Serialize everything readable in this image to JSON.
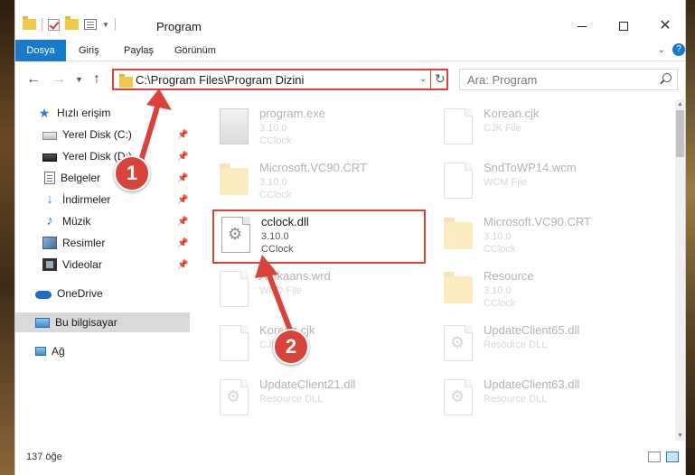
{
  "window": {
    "title": "Program"
  },
  "ribbon": {
    "tabs": [
      {
        "label": "Dosya"
      },
      {
        "label": "Giriş"
      },
      {
        "label": "Paylaş"
      },
      {
        "label": "Görünüm"
      }
    ]
  },
  "address": {
    "path": "C:\\Program Files\\Program Dizini"
  },
  "search": {
    "placeholder": "Ara: Program"
  },
  "sidebar": {
    "items": [
      {
        "label": "Hızlı erişim",
        "icon": "star-icon"
      },
      {
        "label": "Yerel Disk (C:)",
        "icon": "disk-icon",
        "pinned": true
      },
      {
        "label": "Yerel Disk (D:)",
        "icon": "disk-icon",
        "pinned": true
      },
      {
        "label": "Belgeler",
        "icon": "documents-icon",
        "pinned": true
      },
      {
        "label": "İndirmeler",
        "icon": "download-icon",
        "pinned": true
      },
      {
        "label": "Müzik",
        "icon": "music-icon",
        "pinned": true
      },
      {
        "label": "Resimler",
        "icon": "pictures-icon",
        "pinned": true
      },
      {
        "label": "Videolar",
        "icon": "videos-icon",
        "pinned": true
      },
      {
        "label": "OneDrive",
        "icon": "cloud-icon"
      },
      {
        "label": "Bu bilgisayar",
        "icon": "computer-icon",
        "selected": true
      },
      {
        "label": "Ağ",
        "icon": "network-icon"
      }
    ]
  },
  "files": [
    {
      "name": "program.exe",
      "line2": "3.10.0",
      "line3": "CClock",
      "type": "exe"
    },
    {
      "name": "Korean.cjk",
      "line2": "CJK File",
      "line3": "",
      "type": "doc"
    },
    {
      "name": "Microsoft.VC90.CRT",
      "line2": "3.10.0",
      "line3": "CClock",
      "type": "folder"
    },
    {
      "name": "SndToWP14.wcm",
      "line2": "WCM File",
      "line3": "",
      "type": "doc"
    },
    {
      "name": "cclock.dll",
      "line2": "3.10.0",
      "line3": "CClock",
      "type": "dll",
      "highlight": true
    },
    {
      "name": "Microsoft.VC90.CRT",
      "line2": "3.10.0",
      "line3": "CClock",
      "type": "folder"
    },
    {
      "name": "Afrikaans.wrd",
      "line2": "WRD File",
      "line3": "",
      "type": "doc"
    },
    {
      "name": "Resource",
      "line2": "3.10.0",
      "line3": "CClock",
      "type": "folder"
    },
    {
      "name": "Korean.cjk",
      "line2": "CJK File",
      "line3": "",
      "type": "doc"
    },
    {
      "name": "UpdateClient65.dll",
      "line2": "Resource DLL",
      "line3": "",
      "type": "dll"
    },
    {
      "name": "UpdateClient21.dll",
      "line2": "Resource DLL",
      "line3": "",
      "type": "dll"
    },
    {
      "name": "UpdateClient63.dll",
      "line2": "Resource DLL",
      "line3": "",
      "type": "dll"
    }
  ],
  "status": {
    "count": "137 öğe"
  },
  "annotations": {
    "step1": "1",
    "step2": "2"
  },
  "colors": {
    "accent": "#1979ca",
    "annotation": "#d9443a"
  }
}
